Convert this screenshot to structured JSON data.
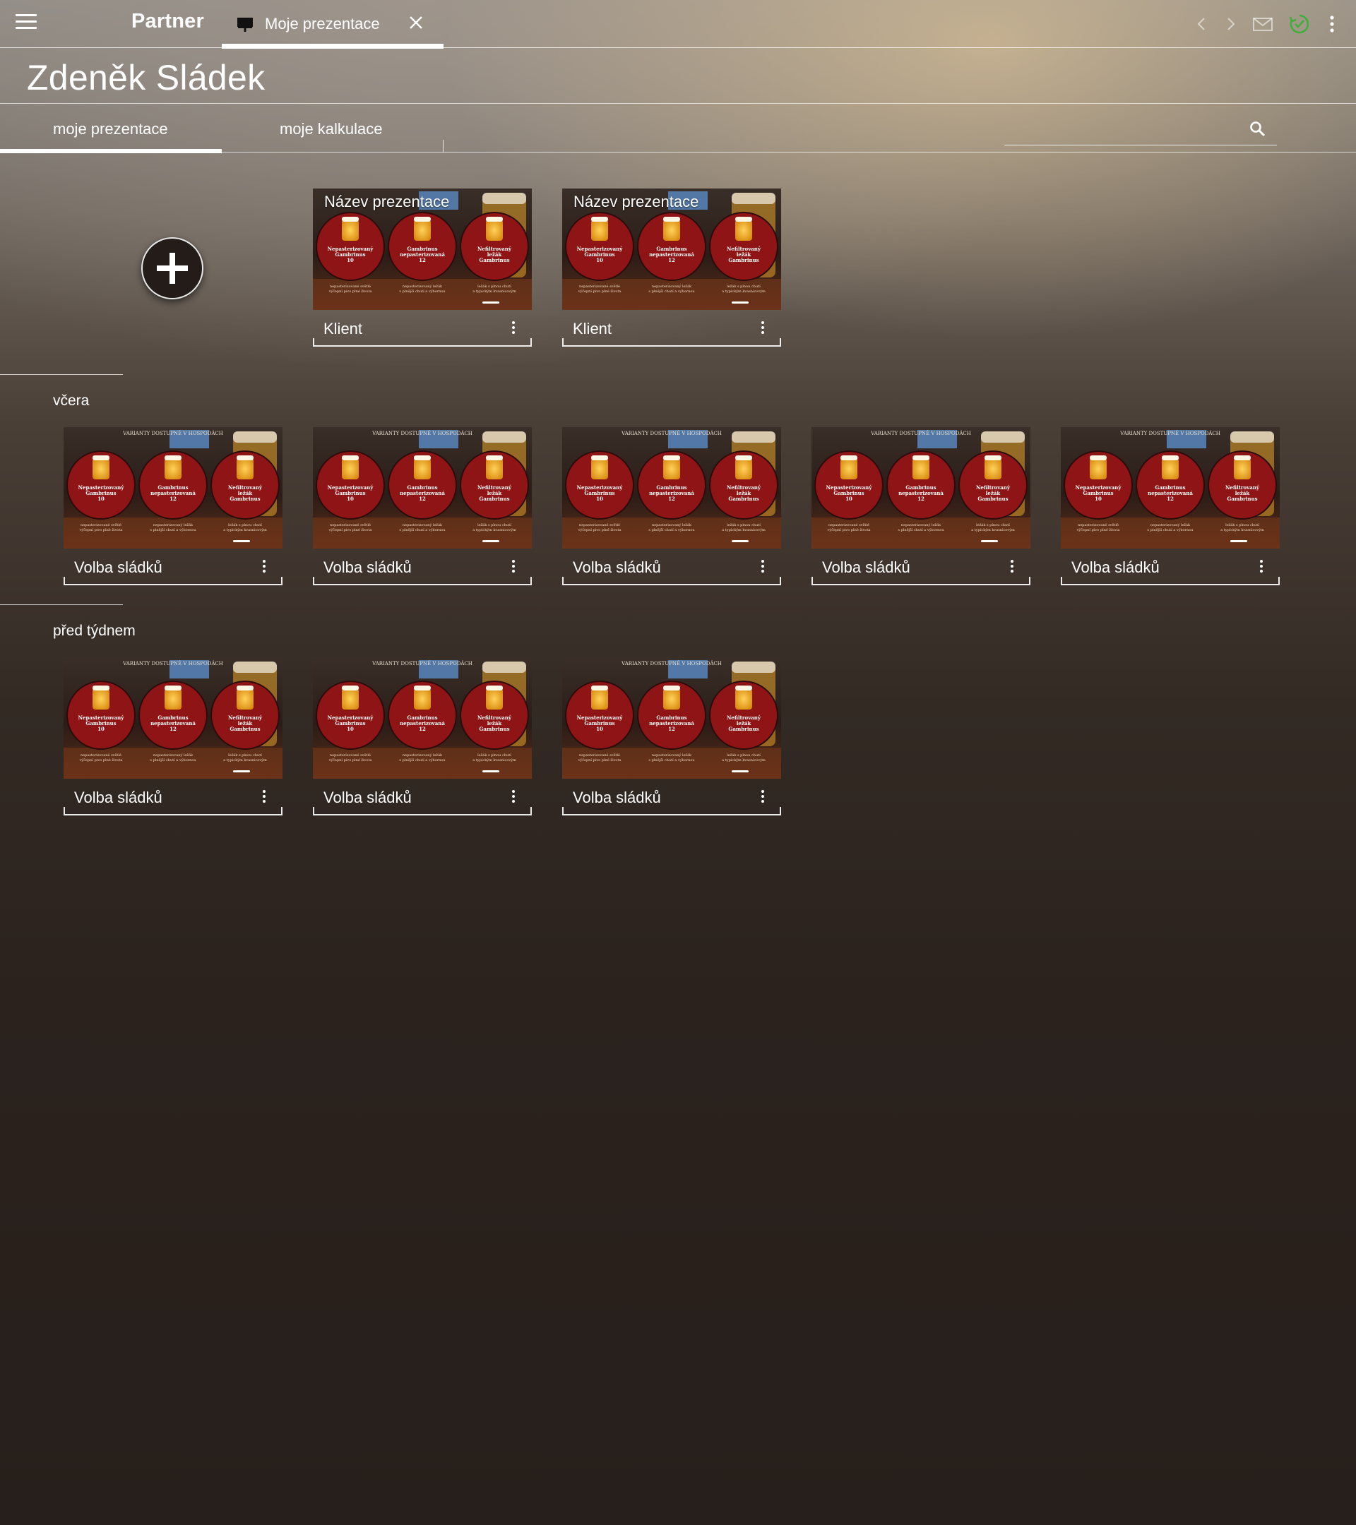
{
  "app": {
    "brand": "Partner",
    "tab": {
      "label": "Moje prezentace"
    },
    "icons": {
      "menu": "hamburger-icon",
      "tab": "presentation-icon",
      "close": "close-icon",
      "back": "chevron-left-icon",
      "forward": "chevron-right-icon",
      "mail": "mail-icon",
      "sync": "sync-check-icon",
      "more": "more-vert-icon"
    },
    "colors": {
      "sync_accent": "#3fae3a"
    }
  },
  "user": {
    "name": "Zdeněk Sládek"
  },
  "subtabs": [
    {
      "label": "moje prezentace",
      "active": true
    },
    {
      "label": "moje kalkulace",
      "active": false
    }
  ],
  "search": {
    "placeholder": ""
  },
  "thumbnail": {
    "banner": "VARIANTY DOSTUPNÉ V HOSPODÁCH",
    "beers": [
      {
        "name": "Nepasterizovaný Gambrinus 10",
        "line1": "Nepasterizovaný",
        "line2": "Gambrinus",
        "line3": "10",
        "desc1": "nepasterizované světlé",
        "desc2": "výčepní pivo plné života"
      },
      {
        "name": "Gambrinus nepasterizovaná 12",
        "line1": "Gambrinus",
        "line2": "nepasterizovaná",
        "line3": "12",
        "desc1": "nepasterizovaný ležák",
        "desc2": "s plnější chutí a výbornou"
      },
      {
        "name": "Nefiltrovaný ležák Gambrinus",
        "line1": "Nefiltrovaný",
        "line2": "ležák",
        "line3": "Gambrinus",
        "desc1": "ležák s plnou chutí",
        "desc2": "a typickým kvasnicovým"
      }
    ]
  },
  "recent": [
    {
      "thumb_title": "Název prezentace",
      "caption": "Klient"
    },
    {
      "thumb_title": "Název prezentace",
      "caption": "Klient"
    }
  ],
  "sections": [
    {
      "label": "včera",
      "cards": [
        {
          "caption": "Volba sládků"
        },
        {
          "caption": "Volba sládků"
        },
        {
          "caption": "Volba sládků"
        },
        {
          "caption": "Volba sládků"
        },
        {
          "caption": "Volba sládků"
        }
      ]
    },
    {
      "label": "před týdnem",
      "cards": [
        {
          "caption": "Volba sládků"
        },
        {
          "caption": "Volba sládků"
        },
        {
          "caption": "Volba sládků"
        }
      ]
    }
  ]
}
